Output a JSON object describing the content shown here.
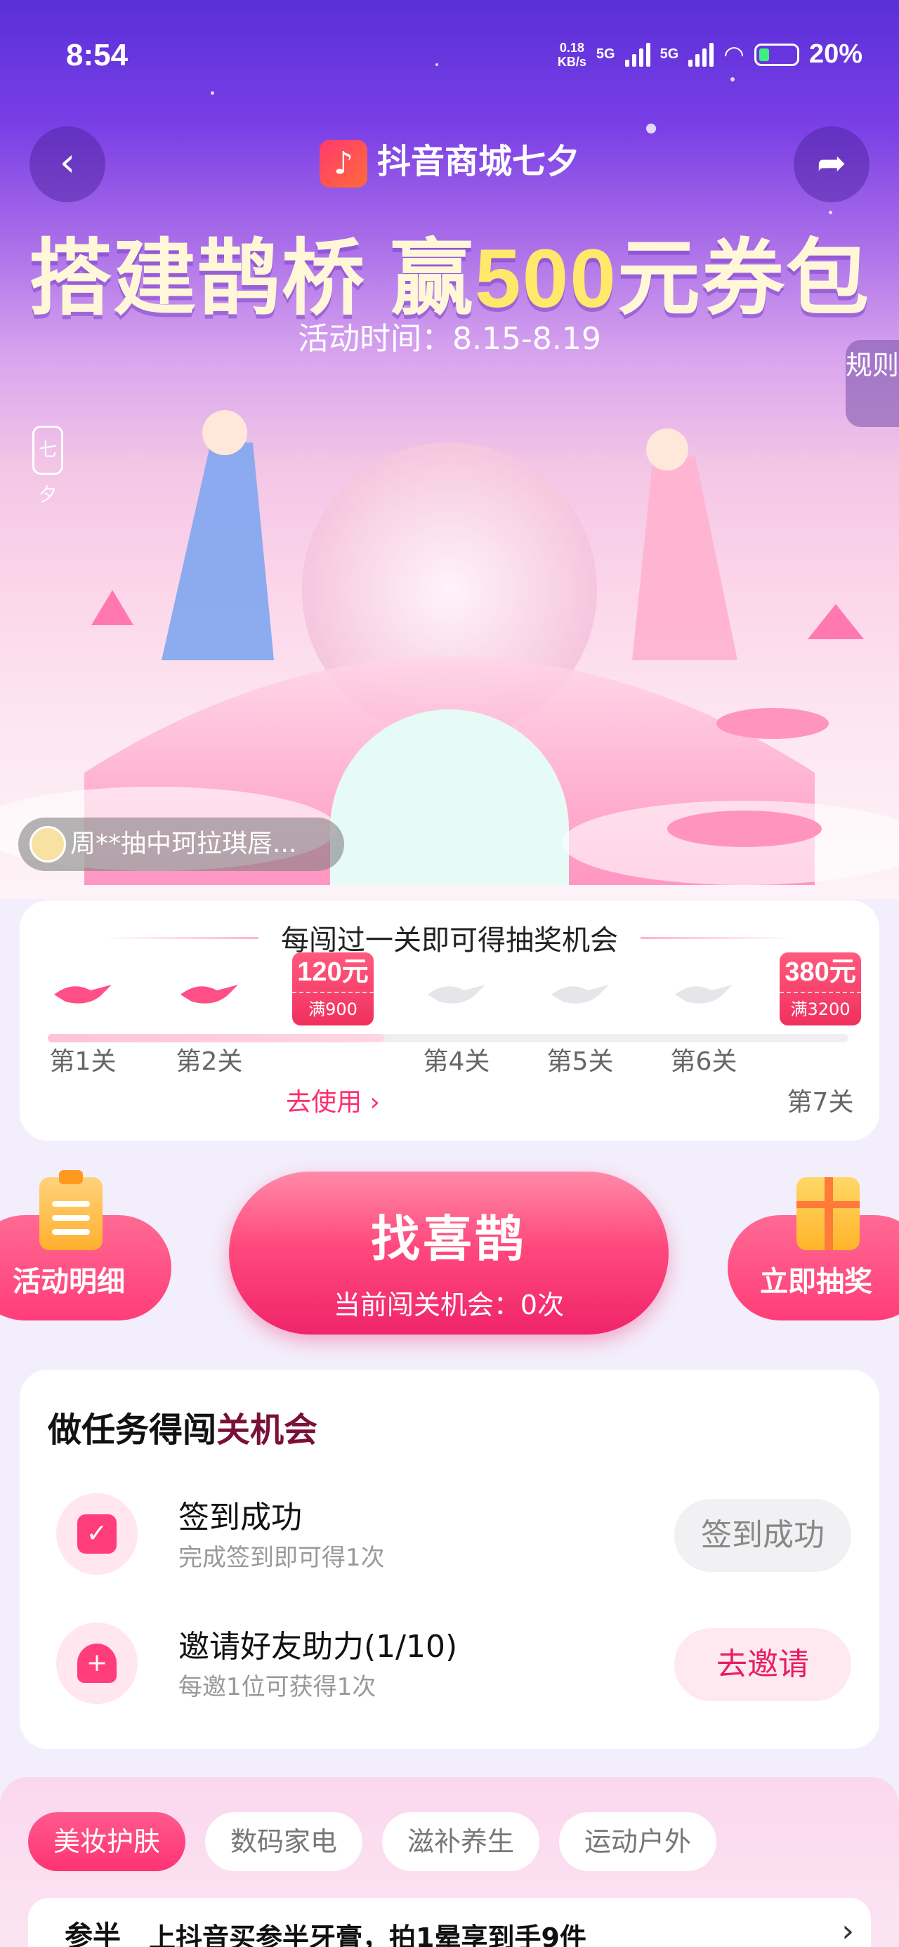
{
  "status_bar": {
    "time": "8:54",
    "speed_value": "0.18",
    "speed_unit": "KB/s",
    "sig1": "5G",
    "sig2": "5G",
    "battery": "20%"
  },
  "header": {
    "brand": "抖音商城七夕",
    "headline_a": "搭建鹊桥 赢",
    "headline_num": "500",
    "headline_b": "元券包",
    "time": "活动时间：8.15-8.19",
    "rules": "规则",
    "seven_badge": "七夕"
  },
  "ticker": {
    "text": "周**抽中珂拉琪唇..."
  },
  "stages": {
    "title": "每闯过一关即可得抽奖机会",
    "items": [
      {
        "label": "第1关"
      },
      {
        "label": "第2关"
      },
      {
        "label": "去使用 ›",
        "coupon_amount": "120元",
        "coupon_cond": "满900"
      },
      {
        "label": "第4关"
      },
      {
        "label": "第5关"
      },
      {
        "label": "第6关"
      },
      {
        "label": "第7关",
        "coupon_amount": "380元",
        "coupon_cond": "满3200"
      }
    ],
    "progress_fraction": 0.42
  },
  "actions": {
    "left_label": "活动明细",
    "main_title": "找喜鹊",
    "main_sub": "当前闯关机会：0次",
    "right_label": "立即抽奖"
  },
  "tasks": {
    "title_a": "做任务得闯",
    "title_b": "关机会",
    "items": [
      {
        "name": "签到成功",
        "desc": "完成签到即可得1次",
        "button": "签到成功",
        "icon": "calendar-check-icon"
      },
      {
        "name": "邀请好友助力(1/10)",
        "desc": "每邀1位可获得1次",
        "button": "去邀请",
        "icon": "person-add-icon"
      }
    ]
  },
  "categories": {
    "tabs": [
      "美妆护肤",
      "数码家电",
      "滋补养生",
      "运动户外"
    ],
    "active_index": 0,
    "promo_tag": "参半",
    "promo_text": "上抖音买参半牙膏，拍1晕享到手9件",
    "promo_arrow": "›"
  },
  "colors": {
    "accent": "#ff3374",
    "hero_top": "#5a2fd8",
    "hero_bottom": "#fdf3f7"
  }
}
